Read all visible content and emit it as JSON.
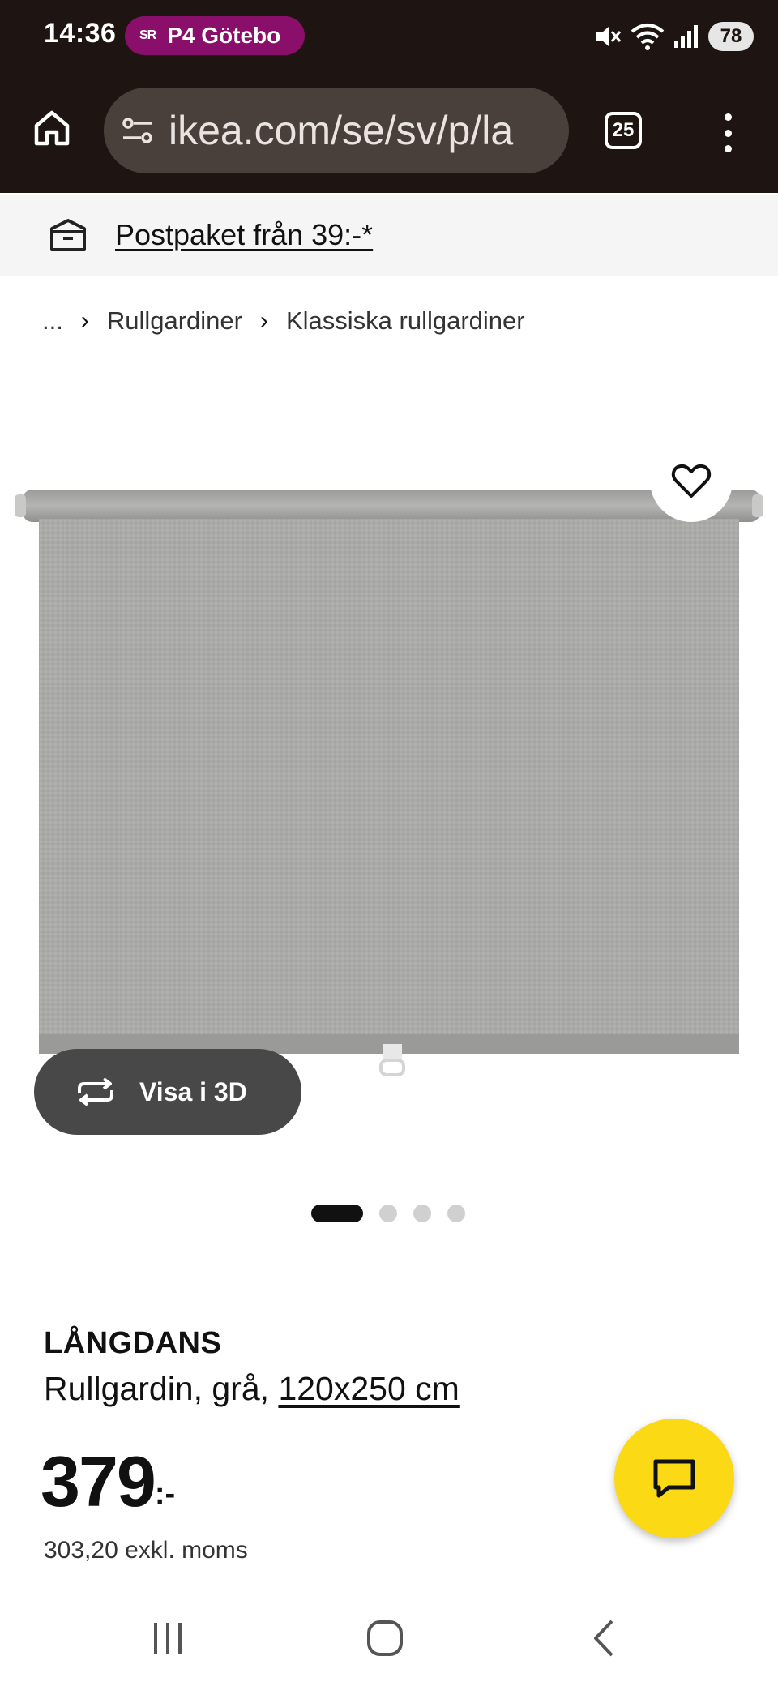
{
  "status_bar": {
    "time": "14:36",
    "radio_badge": {
      "logo": "SR",
      "label": "P4 Götebo"
    },
    "battery": "78"
  },
  "browser": {
    "url": "ikea.com/se/sv/p/la",
    "tab_count": "25"
  },
  "promo": {
    "text": "Postpaket från 39:-*"
  },
  "breadcrumb": {
    "ellipsis": "...",
    "items": [
      "Rullgardiner",
      "Klassiska rullgardiner"
    ]
  },
  "gallery": {
    "view_3d_label": "Visa i 3D",
    "slide_count": 4,
    "active_slide": 1
  },
  "product": {
    "name": "LÅNGDANS",
    "description": "Rullgardin, grå,",
    "size": "120x250 cm",
    "price_integer": "379",
    "price_suffix": ":-",
    "price_ex_vat": "303,20 exkl. moms"
  },
  "colors": {
    "chrome": "#1e1512",
    "radio_pill": "#8a0f6a",
    "chat_fab": "#fbd914",
    "blind_fabric": "#a9a9a7"
  },
  "icons": [
    "home-icon",
    "site-settings-icon",
    "more-vert-icon",
    "delivery-box-icon",
    "chevron-right-icon",
    "heart-icon",
    "rotate-3d-icon",
    "chat-icon",
    "recents-icon",
    "home-nav-icon",
    "back-icon"
  ]
}
